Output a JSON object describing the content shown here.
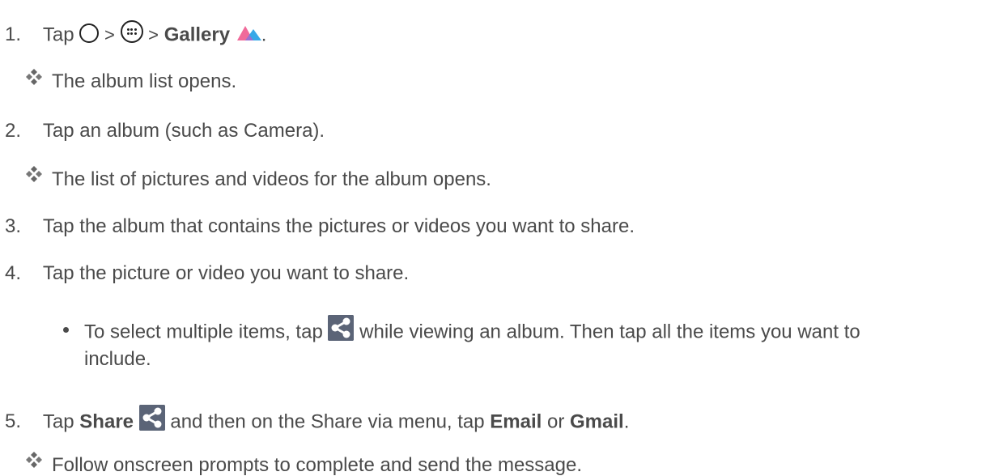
{
  "steps": [
    {
      "number": "1.",
      "parts": {
        "tap": "Tap",
        "sep1": ">",
        "sep2": ">",
        "gallery": "Gallery",
        "end": "."
      },
      "icons": [
        "home-icon",
        "apps-icon",
        "gallery-icon"
      ]
    },
    {
      "result": "The album list opens."
    },
    {
      "number": "2.",
      "text": "Tap an album (such as Camera)."
    },
    {
      "result": "The list of pictures and videos for the album opens."
    },
    {
      "number": "3.",
      "text": "Tap the album that contains the pictures or videos you want to share."
    },
    {
      "number": "4.",
      "text": "Tap the picture or video you want to share."
    },
    {
      "bullet": {
        "before": "To select multiple items, tap",
        "after": "while viewing an album. Then tap all the items you want to",
        "continuation": "include."
      },
      "icon": "share-icon"
    },
    {
      "number": "5.",
      "parts": {
        "tap": "Tap",
        "share": "Share",
        "middle": "and then on the Share via menu, tap",
        "email": "Email",
        "or": "or",
        "gmail": "Gmail",
        "end": "."
      },
      "icon": "share-icon"
    },
    {
      "result": "Follow onscreen prompts to complete and send the message."
    }
  ],
  "colors": {
    "text": "#4a4a4a",
    "icon_dark": "#222222",
    "share_bg": "#5b6477",
    "gallery_pink": "#f06a9a",
    "gallery_blue": "#38a8e8"
  }
}
